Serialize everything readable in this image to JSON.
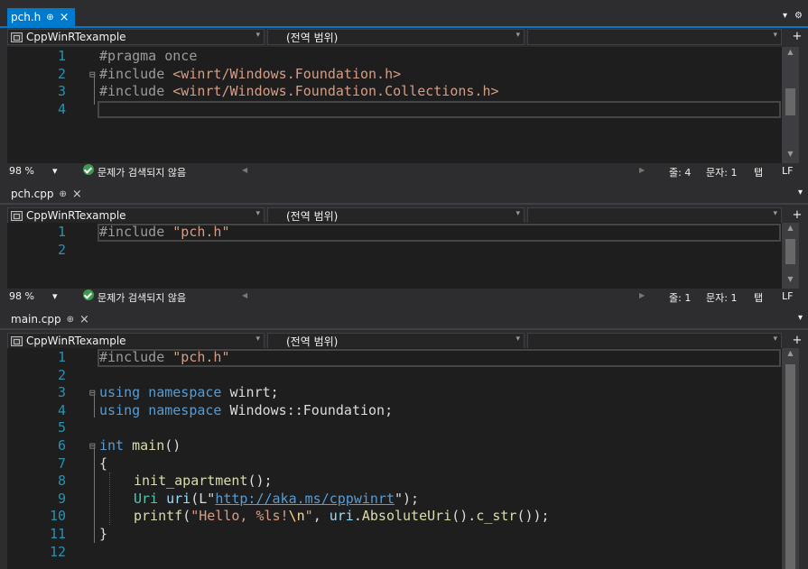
{
  "panes": [
    {
      "tab": {
        "label": "pch.h",
        "pin": "⊕",
        "close": "×"
      },
      "nav": {
        "project": "CppWinRTexample",
        "scope": "(전역 범위)",
        "member": ""
      },
      "status": {
        "zoom": "98 %",
        "issues": "문제가 검색되지 않음",
        "line": "줄: 4",
        "col": "문자: 1",
        "tab": "탭",
        "eol": "LF"
      }
    },
    {
      "tab": {
        "label": "pch.cpp",
        "pin": "⊕",
        "close": "×"
      },
      "nav": {
        "project": "CppWinRTexample",
        "scope": "(전역 범위)",
        "member": ""
      },
      "status": {
        "zoom": "98 %",
        "issues": "문제가 검색되지 않음",
        "line": "줄: 1",
        "col": "문자: 1",
        "tab": "탭",
        "eol": "LF"
      }
    },
    {
      "tab": {
        "label": "main.cpp",
        "pin": "⊕",
        "close": "×"
      },
      "nav": {
        "project": "CppWinRTexample",
        "scope": "(전역 범위)",
        "member": ""
      }
    }
  ],
  "line_numbers": {
    "pch_h": [
      "1",
      "2",
      "3",
      "4"
    ],
    "pch_cpp": [
      "1",
      "2"
    ],
    "main_cpp": [
      "1",
      "2",
      "3",
      "4",
      "5",
      "6",
      "7",
      "8",
      "9",
      "10",
      "11",
      "12"
    ]
  },
  "code": {
    "pch_h": {
      "l1": "#pragma once",
      "l2_dir": "#include ",
      "l2_str": "<winrt/Windows.Foundation.h>",
      "l3_dir": "#include ",
      "l3_str": "<winrt/Windows.Foundation.Collections.h>"
    },
    "pch_cpp": {
      "l1_dir": "#include ",
      "l1_str": "\"pch.h\""
    },
    "main_cpp": {
      "l1_dir": "#include ",
      "l1_str": "\"pch.h\"",
      "l3_kw1": "using",
      "l3_kw2": "namespace",
      "l3_rest": " winrt;",
      "l4_kw1": "using",
      "l4_kw2": "namespace",
      "l4_rest": " Windows::Foundation;",
      "l6_kw": "int",
      "l6_fn": "main",
      "l6_rest": "()",
      "l7": "{",
      "l8_fn": "init_apartment",
      "l8_rest": "();",
      "l9_ty": "Uri",
      "l9_var": "uri",
      "l9_a": "(L\"",
      "l9_url": "http://aka.ms/cppwinrt",
      "l9_b": "\");",
      "l10_fn": "printf",
      "l10_a": "(",
      "l10_str1": "\"Hello, %ls!",
      "l10_esc": "\\n",
      "l10_str2": "\"",
      "l10_b": ", ",
      "l10_var": "uri",
      "l10_c": ".",
      "l10_fn2": "AbsoluteUri",
      "l10_d": "().",
      "l10_fn3": "c_str",
      "l10_e": "());",
      "l11": "}"
    }
  },
  "icons": {
    "dropdown": "▾",
    "settings": "⚙",
    "fold_open": "⊟",
    "scroll_up": "▲",
    "scroll_down": "▼",
    "scroll_left": "◀",
    "scroll_right": "▶",
    "split": "+"
  },
  "colors": {
    "accent": "#007acc",
    "editor_bg": "#1e1e1e",
    "line_number": "#2b91af"
  }
}
